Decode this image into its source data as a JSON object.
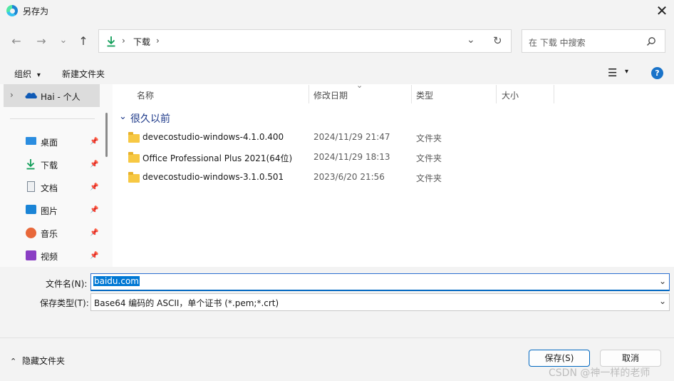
{
  "window": {
    "title": "另存为",
    "close_glyph": "✕"
  },
  "nav": {
    "back": "←",
    "forward": "→",
    "recent": "⌄",
    "up": "↑",
    "path_icon": "download-arrow-icon",
    "breadcrumb_sep1": "›",
    "breadcrumb": "下载",
    "breadcrumb_sep2": "›",
    "dropdown_glyph": "⌄",
    "refresh_glyph": "↻",
    "search_placeholder": "在 下载 中搜索",
    "search_glyph": "⌕"
  },
  "toolbar": {
    "organize": "组织",
    "organize_caret": "▾",
    "new_folder": "新建文件夹",
    "view_glyph": "☰",
    "view_caret": "▾",
    "help_glyph": "?"
  },
  "sidebar": {
    "onedrive_label": "Hai - 个人",
    "expand_glyph": "›",
    "pin_glyph": "📌",
    "items": [
      {
        "label": "桌面",
        "icon": "desktop-icon"
      },
      {
        "label": "下载",
        "icon": "download-icon"
      },
      {
        "label": "文档",
        "icon": "document-icon"
      },
      {
        "label": "图片",
        "icon": "pictures-icon"
      },
      {
        "label": "音乐",
        "icon": "music-icon"
      },
      {
        "label": "视频",
        "icon": "video-icon"
      }
    ]
  },
  "files": {
    "columns": [
      "名称",
      "修改日期",
      "类型",
      "大小"
    ],
    "sort_glyph": "⌄",
    "group_label": "很久以前",
    "group_caret": "⌄",
    "rows": [
      {
        "name": "devecostudio-windows-4.1.0.400",
        "date": "2024/11/29 21:47",
        "type": "文件夹"
      },
      {
        "name": "Office Professional Plus 2021(64位)",
        "date": "2024/11/29 18:13",
        "type": "文件夹"
      },
      {
        "name": "devecostudio-windows-3.1.0.501",
        "date": "2023/6/20 21:56",
        "type": "文件夹"
      }
    ]
  },
  "form": {
    "filename_label": "文件名(N):",
    "filename_value": "baidu.com",
    "filetype_label": "保存类型(T):",
    "filetype_value": "Base64 编码的 ASCII，单个证书 (*.pem;*.crt)",
    "dropdown_glyph": "⌄"
  },
  "footer": {
    "hide_folders_caret": "⌃",
    "hide_folders": "隐藏文件夹",
    "save": "保存(S)",
    "cancel": "取消",
    "watermark": "CSDN @神一样的老师"
  },
  "colors": {
    "accent": "#0067c0",
    "folder": "#f7c843",
    "selection": "#0078d4"
  }
}
